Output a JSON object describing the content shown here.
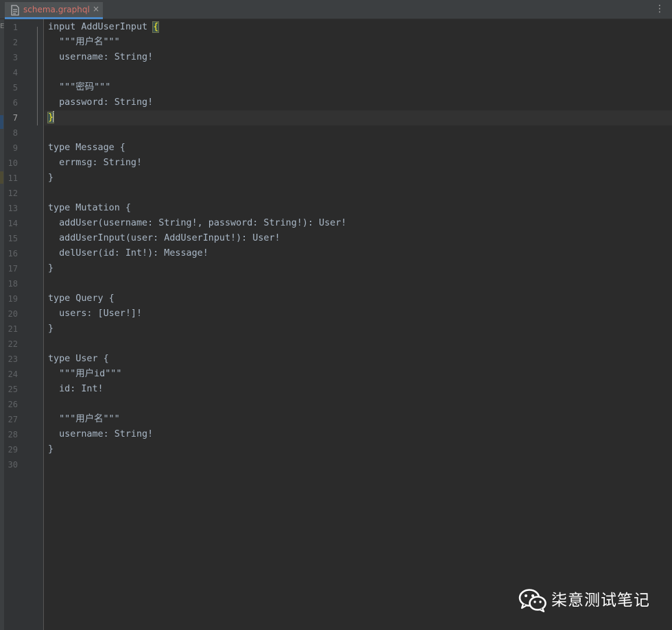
{
  "tab": {
    "label": "schema.graphql",
    "close": "×"
  },
  "toolbar": {
    "menu": "⋮"
  },
  "left_strip": {
    "mark": "E"
  },
  "editor": {
    "current_line": 7,
    "lines": [
      "input AddUserInput {",
      "  \"\"\"用户名\"\"\"",
      "  username: String!",
      "",
      "  \"\"\"密码\"\"\"",
      "  password: String!",
      "}",
      "",
      "type Message {",
      "  errmsg: String!",
      "}",
      "",
      "type Mutation {",
      "  addUser(username: String!, password: String!): User!",
      "  addUserInput(user: AddUserInput!): User!",
      "  delUser(id: Int!): Message!",
      "}",
      "",
      "type Query {",
      "  users: [User!]!",
      "}",
      "",
      "type User {",
      "  \"\"\"用户id\"\"\"",
      "  id: Int!",
      "",
      "  \"\"\"用户名\"\"\"",
      "  username: String!",
      "}",
      ""
    ]
  },
  "watermark": {
    "text": "柒意测试笔记",
    "icon": "wechat-icon"
  },
  "colors": {
    "background": "#2b2b2b",
    "gutter": "#313335",
    "text": "#a9b7c6",
    "tab_text": "#d5736b",
    "tab_underline": "#4a88c7",
    "check": "#5fb832",
    "brace_highlight": "#ffef28"
  }
}
